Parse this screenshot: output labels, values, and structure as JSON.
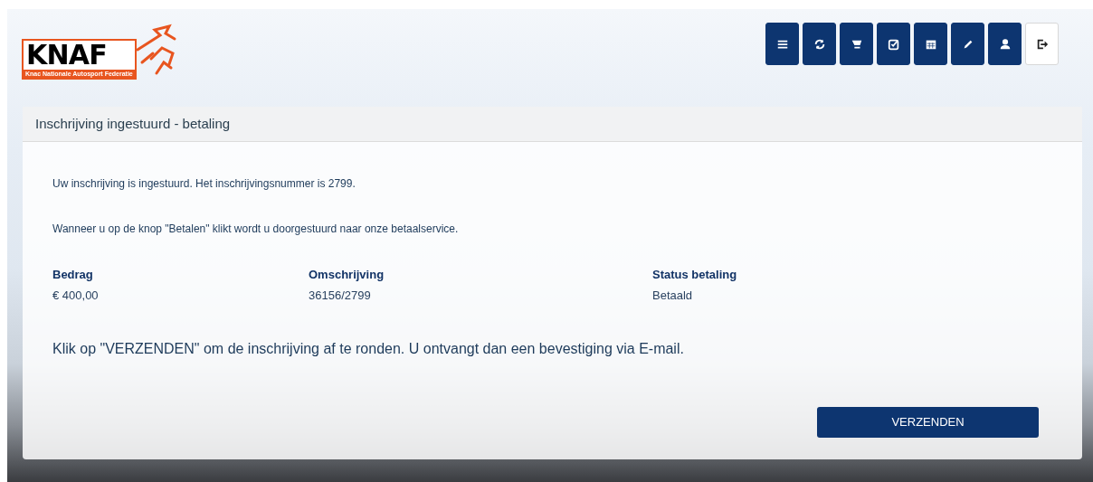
{
  "logo": {
    "name": "KNAF",
    "subtitle": "Knac Nationale Autosport Federatie"
  },
  "toolbar": [
    {
      "kind": "list"
    },
    {
      "kind": "refresh"
    },
    {
      "kind": "cart"
    },
    {
      "kind": "check"
    },
    {
      "kind": "calendar"
    },
    {
      "kind": "pencil"
    },
    {
      "kind": "user"
    },
    {
      "kind": "logout"
    }
  ],
  "panel": {
    "title": "Inschrijving ingestuurd - betaling",
    "messages": [
      "Uw inschrijving is ingestuurd. Het inschrijvingsnummer is 2799.",
      "Wanneer u op de knop \"Betalen\" klikt wordt u doorgestuurd naar onze betaalservice."
    ],
    "fields": [
      {
        "label": "Bedrag",
        "value": "€ 400,00"
      },
      {
        "label": "Omschrijving",
        "value": "36156/2799"
      },
      {
        "label": "Status betaling",
        "value": "Betaald"
      }
    ],
    "instruction": "Klik op \"VERZENDEN\" om de inschrijving af te ronden. U ontvangt dan een bevestiging via E-mail.",
    "button": "VERZENDEN"
  }
}
